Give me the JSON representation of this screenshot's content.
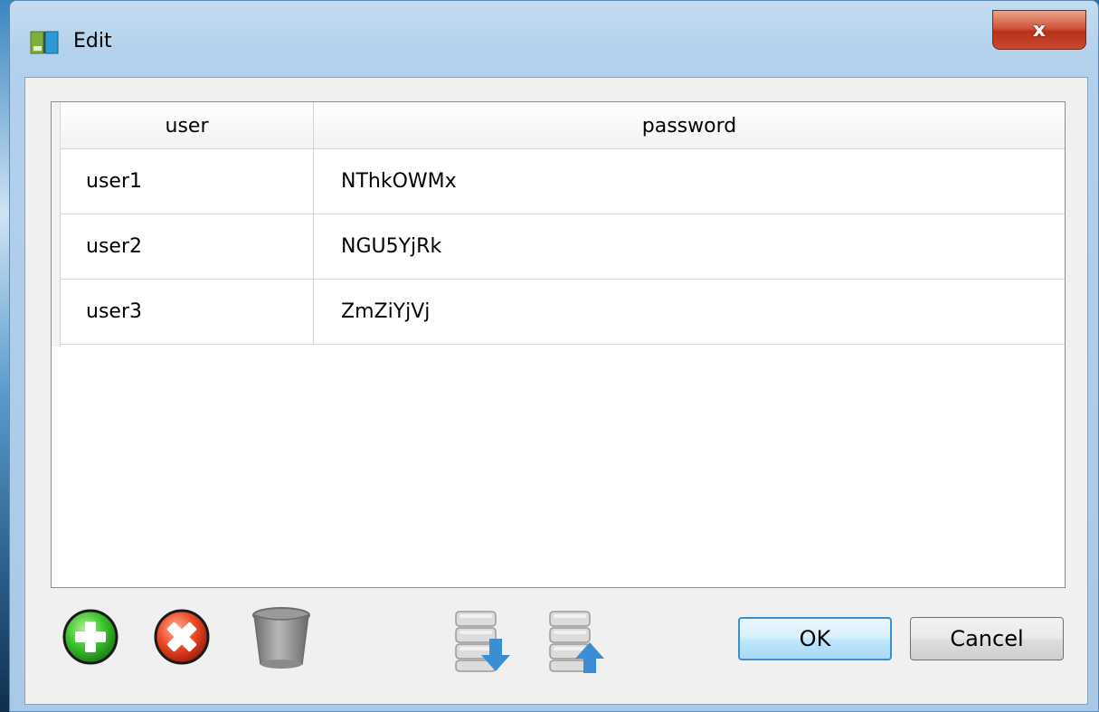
{
  "window": {
    "title": "Edit",
    "close_label": "x"
  },
  "table": {
    "columns": [
      "user",
      "password"
    ],
    "rows": [
      {
        "user": "user1",
        "password": "NThkOWMx"
      },
      {
        "user": "user2",
        "password": "NGU5YjRk"
      },
      {
        "user": "user3",
        "password": "ZmZiYjVj"
      }
    ]
  },
  "toolbar": {
    "icons": [
      "add-icon",
      "remove-icon",
      "trash-icon",
      "import-database-icon",
      "export-database-icon"
    ]
  },
  "buttons": {
    "ok_label": "OK",
    "cancel_label": "Cancel"
  },
  "colors": {
    "add": "#2fb52b",
    "remove": "#e0341c",
    "ok_border": "#3c8fd4",
    "database_arrow": "#3b8ed6"
  }
}
